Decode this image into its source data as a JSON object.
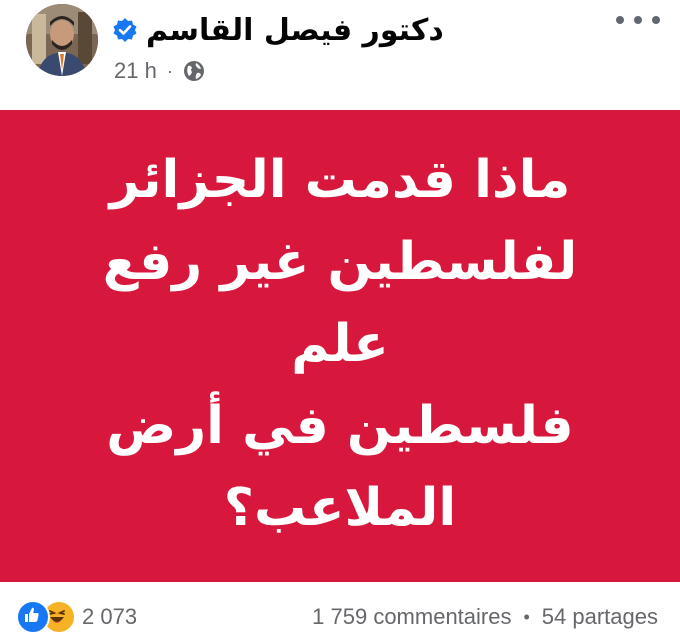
{
  "header": {
    "author_name": "دكتور فيصل القاسم",
    "time": "21 h",
    "separator": "·"
  },
  "card": {
    "background": "#d8173c",
    "text_lines": [
      "ماذا قدمت الجزائر",
      "لفلسطين غير رفع علم",
      "فلسطين في أرض",
      "الملاعب؟"
    ]
  },
  "footer": {
    "reactions": [
      "like-icon",
      "haha-icon"
    ],
    "reaction_count": "2 073",
    "comments": "1 759 commentaires",
    "bullet": "•",
    "shares": "54 partages"
  },
  "colors": {
    "verified_blue": "#1877f2",
    "secondary_text": "#65676b"
  }
}
